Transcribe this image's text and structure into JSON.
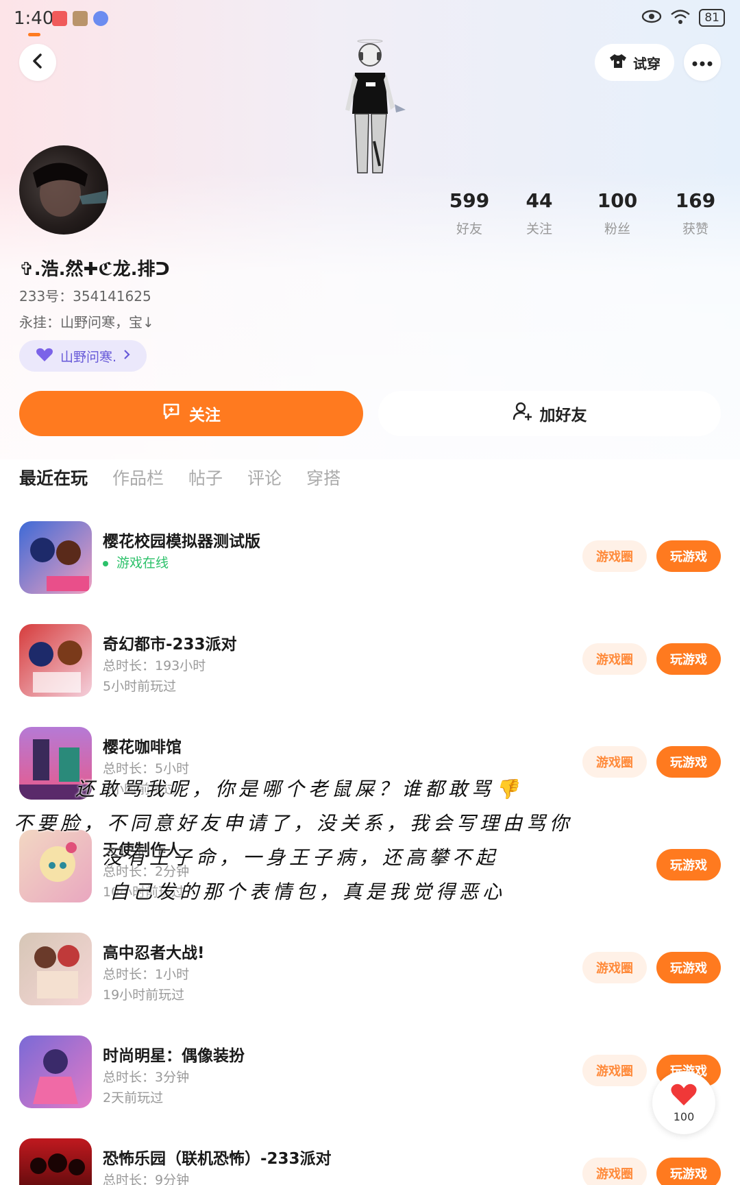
{
  "status_bar": {
    "time": "1:40",
    "battery": "81"
  },
  "header": {
    "try_on_label": "试穿"
  },
  "profile": {
    "stats": [
      {
        "value": "599",
        "label": "好友"
      },
      {
        "value": "44",
        "label": "关注"
      },
      {
        "value": "100",
        "label": "粉丝"
      },
      {
        "value": "169",
        "label": "获赞"
      }
    ],
    "username": "✞.浩.然✚ℭ龙.排ᑐ",
    "uid": "233号：354141625",
    "signature": "永挂：山野问寒，宝↓",
    "tag": "山野问寒."
  },
  "actions": {
    "follow_label": "关注",
    "add_friend_label": "加好友"
  },
  "tabs": [
    "最近在玩",
    "作品栏",
    "帖子",
    "评论",
    "穿搭"
  ],
  "game_button_labels": {
    "circle": "游戏圈",
    "play": "玩游戏"
  },
  "games": [
    {
      "title": "樱花校园模拟器测试版",
      "status": "游戏在线",
      "sub1": "",
      "sub2": ""
    },
    {
      "title": "奇幻都市-233派对",
      "sub1": "总时长：193小时",
      "sub2": "5小时前玩过"
    },
    {
      "title": "樱花咖啡馆",
      "sub1": "总时长：5小时",
      "sub2": "6小时前玩过"
    },
    {
      "title": "天使制作人",
      "sub1": "总时长：2分钟",
      "sub2": "10小时前玩过"
    },
    {
      "title": "高中忍者大战!",
      "sub1": "总时长：1小时",
      "sub2": "19小时前玩过"
    },
    {
      "title": "时尚明星：偶像装扮",
      "sub1": "总时长：3分钟",
      "sub2": "2天前玩过"
    },
    {
      "title": "恐怖乐园（联机恐怖）-233派对",
      "sub1": "总时长：9分钟",
      "sub2": ""
    }
  ],
  "overlay": {
    "lines": [
      "还敢骂我呢，你是哪个老鼠屎？谁都敢骂👎",
      "不要脸，不同意好友申请了，没关系，我会写理由骂你",
      "没有王子命，一身王子病，还高攀不起",
      "自己发的那个表情包，真是我觉得恶心"
    ]
  },
  "like_fab": {
    "count": "100"
  },
  "colors": {
    "accent": "#ff7a1f",
    "online": "#2cc16a",
    "tag": "#6658d8"
  }
}
